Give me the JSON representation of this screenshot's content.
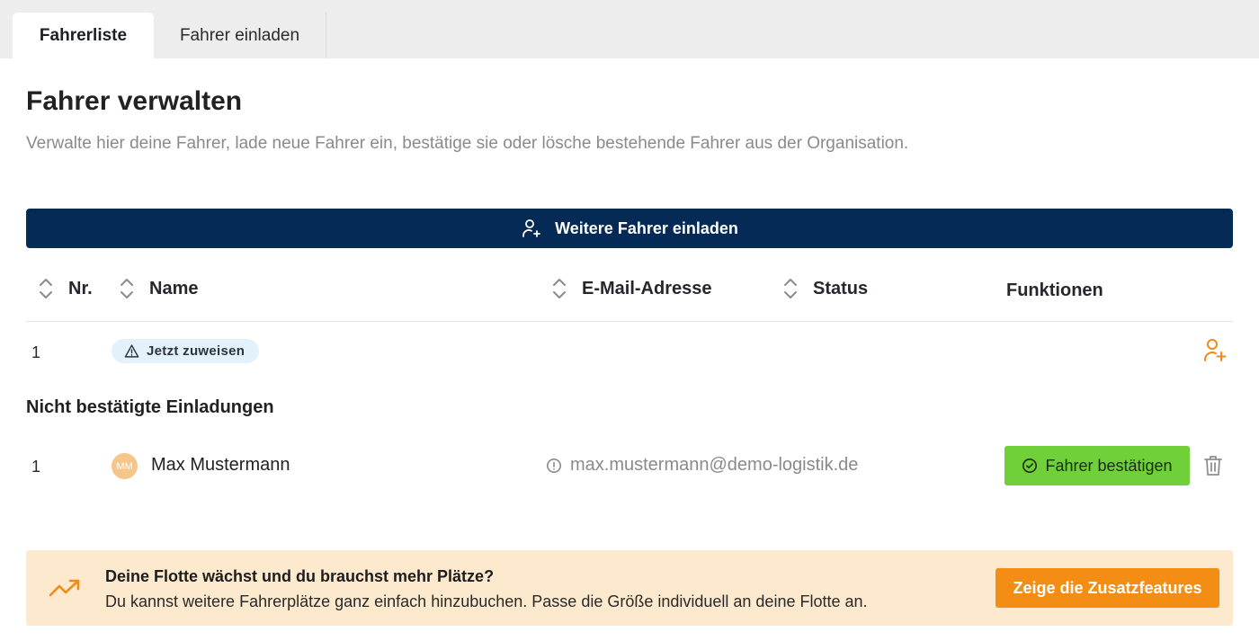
{
  "tabs": [
    {
      "label": "Fahrerliste",
      "active": true
    },
    {
      "label": "Fahrer einladen",
      "active": false
    }
  ],
  "page": {
    "title": "Fahrer verwalten",
    "subtitle": "Verwalte hier deine Fahrer, lade neue Fahrer ein, bestätige sie oder lösche bestehende Fahrer aus der Organisation."
  },
  "invite_button": {
    "label": "Weitere Fahrer einladen",
    "icon": "user-plus-icon"
  },
  "table": {
    "headers": {
      "nr": "Nr.",
      "name": "Name",
      "email": "E-Mail-Adresse",
      "status": "Status",
      "functions": "Funktionen"
    },
    "rows": [
      {
        "nr": "1",
        "badge": "Jetzt zuweisen",
        "badge_icon": "warning-triangle-icon",
        "action_icon": "user-plus-icon"
      }
    ]
  },
  "pending": {
    "section_title": "Nicht bestätigte Einladungen",
    "rows": [
      {
        "nr": "1",
        "initials": "MM",
        "name": "Max Mustermann",
        "email": "max.mustermann@demo-logistik.de",
        "email_icon": "info-icon",
        "confirm_label": "Fahrer bestätigen",
        "delete_icon": "trash-icon"
      }
    ]
  },
  "promo": {
    "title": "Deine Flotte wächst und du brauchst mehr Plätze?",
    "text": "Du kannst weitere Fahrerplätze ganz einfach hinzubuchen. Passe die Größe individuell an deine Flotte an.",
    "button": "Zeige die Zusatzfeatures",
    "icon": "trending-up-icon"
  },
  "colors": {
    "primary": "#062a56",
    "success": "#6fd03a",
    "accent": "#f48d13",
    "promo_bg": "#fde9cd",
    "badge_bg": "#e3f1fb"
  }
}
